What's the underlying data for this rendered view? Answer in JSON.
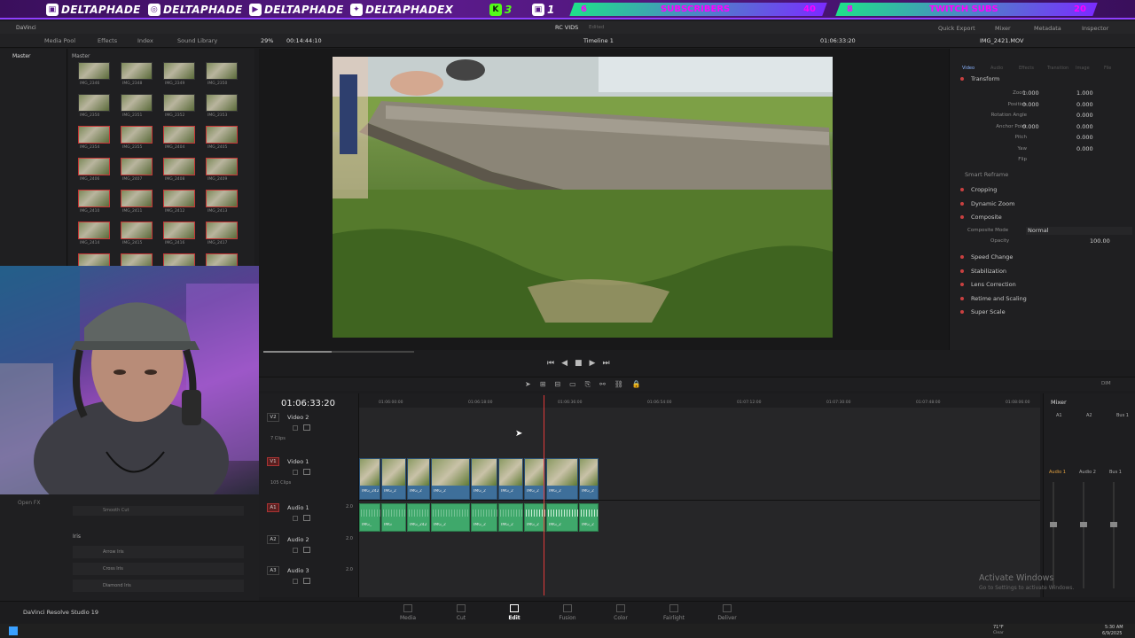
{
  "banner": {
    "socials": [
      {
        "icon": "twitch-icon",
        "handle": "DELTAPHADE"
      },
      {
        "icon": "instagram-icon",
        "handle": "DELTAPHADE"
      },
      {
        "icon": "youtube-icon",
        "handle": "DELTAPHADE"
      },
      {
        "icon": "twitter-icon",
        "handle": "DELTAPHADEX"
      }
    ],
    "kick_count": "3",
    "twitch_count": "1",
    "subscribers": {
      "current": "6",
      "label": "SUBSCRIBERS",
      "goal": "40"
    },
    "twitch_subs": {
      "current": "8",
      "label": "TWITCH SUBS",
      "goal": "20"
    }
  },
  "app": {
    "menu_items": [
      "DaVinci"
    ],
    "project_name": "RC VIDS",
    "project_status": "Edited",
    "toolbar": {
      "media_pool": "Media Pool",
      "effects": "Effects",
      "index": "Index",
      "sound_library": "Sound Library",
      "quick_export": "Quick Export",
      "mixer": "Mixer",
      "metadata": "Metadata",
      "inspector": "Inspector"
    },
    "app_name": "DaVinci Resolve Studio 19"
  },
  "media_pool": {
    "bin_left": "Master",
    "bin_right": "Master",
    "clips": [
      "IMG_2346",
      "IMG_2348",
      "IMG_2349",
      "IMG_2350",
      "IMG_2350",
      "IMG_2351",
      "IMG_2352",
      "IMG_2353",
      "IMG_2354",
      "IMG_2355",
      "IMG_2404",
      "IMG_2405",
      "IMG_2406",
      "IMG_2407",
      "IMG_2408",
      "IMG_2409",
      "IMG_2410",
      "IMG_2411",
      "IMG_2412",
      "IMG_2413",
      "IMG_2414",
      "IMG_2415",
      "IMG_2416",
      "IMG_2417",
      "IMG_2418",
      "IMG_2419",
      "IMG_2420",
      "IMG_2421"
    ]
  },
  "viewer": {
    "zoom": "29%",
    "source_timecode": "00:14:44:10",
    "timeline_name": "Timeline 1",
    "record_timecode": "01:06:33:20",
    "playhead_fraction": 0.45
  },
  "inspector": {
    "clip_name": "IMG_2421.MOV",
    "tabs": [
      "Video",
      "Audio",
      "Effects",
      "Transition",
      "Image",
      "File"
    ],
    "transform_title": "Transform",
    "params": [
      {
        "label": "Zoom",
        "x": "1.000",
        "y": "1.000"
      },
      {
        "label": "Position",
        "x": "0.000",
        "y": "0.000"
      },
      {
        "label": "Rotation Angle",
        "x": "",
        "y": "0.000"
      },
      {
        "label": "Anchor Point",
        "x": "0.000",
        "y": "0.000"
      },
      {
        "label": "Pitch",
        "x": "",
        "y": "0.000"
      },
      {
        "label": "Yaw",
        "x": "",
        "y": "0.000"
      },
      {
        "label": "Flip",
        "x": "",
        "y": ""
      }
    ],
    "smart_reframe": "Smart Reframe",
    "sections": [
      "Cropping",
      "Dynamic Zoom",
      "Composite"
    ],
    "composite_mode_label": "Composite Mode",
    "composite_mode_value": "Normal",
    "opacity_label": "Opacity",
    "opacity_value": "100.00",
    "sections2": [
      "Speed Change",
      "Stabilization",
      "Lens Correction",
      "Retime and Scaling",
      "Super Scale"
    ]
  },
  "timeline": {
    "timecode": "01:06:33:20",
    "ruler": [
      "01:06:00:00",
      "01:06:18:00",
      "01:06:36:00",
      "01:06:54:00",
      "01:07:12:00",
      "01:07:30:00",
      "01:07:48:00",
      "01:08:06:00"
    ],
    "tracks": [
      {
        "badge": "V2",
        "name": "Video 2",
        "sub": "7 Clips"
      },
      {
        "badge": "V1",
        "name": "Video 1",
        "sub": "105 Clips"
      },
      {
        "badge": "A1",
        "name": "Audio 1",
        "sub": "2.0"
      },
      {
        "badge": "A2",
        "name": "Audio 2",
        "sub": "2.0"
      },
      {
        "badge": "A3",
        "name": "Audio 3",
        "sub": "2.0"
      }
    ],
    "video_clip_labels": [
      "IMG_242",
      "IMG_2",
      "IMG_2",
      "IMG_2",
      "IMG_2",
      "IMG_2",
      "IMG_2",
      "IMG_2",
      "IMG_2"
    ],
    "audio_clip_labels": [
      "IMG_",
      "IMG",
      "IMG_242",
      "IMG_2",
      "IMG_2",
      "IMG_2",
      "IMG_2",
      "IMG_2",
      "IMG_2"
    ]
  },
  "mixer": {
    "title": "Mixer",
    "channels": [
      "A1",
      "A2",
      "Bus 1"
    ],
    "strips": [
      "Audio 1",
      "Audio 2",
      "Bus 1"
    ],
    "dim": "DIM"
  },
  "effects_panel": {
    "items": [
      "Open FX",
      "Smooth Cut"
    ],
    "section": "Iris",
    "iris_items": [
      "Arrow Iris",
      "Cross Iris",
      "Diamond Iris"
    ]
  },
  "pages": [
    "Media",
    "Cut",
    "Edit",
    "Fusion",
    "Color",
    "Fairlight",
    "Deliver"
  ],
  "active_page": "Edit",
  "watermark": {
    "line1": "Activate Windows",
    "line2": "Go to Settings to activate Windows."
  },
  "taskbar": {
    "weather": "71°F",
    "weather_sub": "Clear",
    "time": "5:30 AM",
    "date": "6/9/2025"
  },
  "colors": {
    "accent": "#8f3fff",
    "playhead": "#e03a3a",
    "video_clip": "#3e6f9a",
    "audio_clip": "#3fa86b",
    "active_page": "#ffffff"
  }
}
